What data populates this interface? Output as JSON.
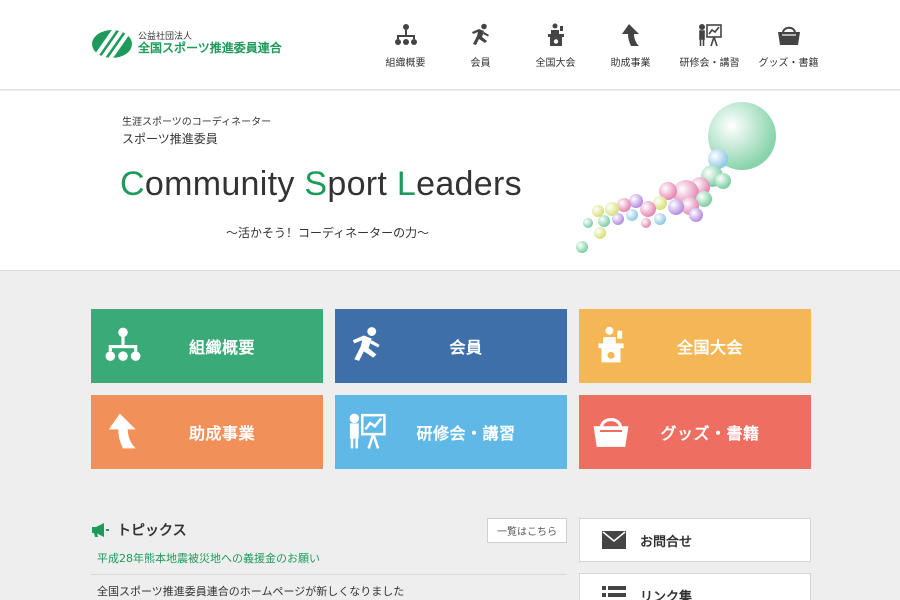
{
  "logo": {
    "sub": "公益社団法人",
    "main": "全国スポーツ推進委員連合"
  },
  "nav": [
    {
      "label": "組織概要",
      "icon": "org-chart-icon"
    },
    {
      "label": "会員",
      "icon": "runner-icon"
    },
    {
      "label": "全国大会",
      "icon": "podium-speaker-icon"
    },
    {
      "label": "助成事業",
      "icon": "up-arrow-icon"
    },
    {
      "label": "研修会・講習",
      "icon": "presentation-icon"
    },
    {
      "label": "グッズ・書籍",
      "icon": "basket-icon"
    }
  ],
  "hero": {
    "small": "生涯スポーツのコーディネーター",
    "sub": "スポーツ推進委員",
    "title_parts": [
      "C",
      "ommunity ",
      "S",
      "port ",
      "L",
      "eaders"
    ],
    "tagline": "〜活かそう！コーディネーターの力〜"
  },
  "tiles": [
    {
      "label": "組織概要",
      "icon": "org-chart-icon",
      "color": "#3aaa78"
    },
    {
      "label": "会員",
      "icon": "runner-icon",
      "color": "#3f6fa9"
    },
    {
      "label": "全国大会",
      "icon": "podium-speaker-icon",
      "color": "#f5b755"
    },
    {
      "label": "助成事業",
      "icon": "up-arrow-icon",
      "color": "#f29059"
    },
    {
      "label": "研修会・講習",
      "icon": "presentation-icon",
      "color": "#5fb8e6"
    },
    {
      "label": "グッズ・書籍",
      "icon": "basket-icon",
      "color": "#ee6f62"
    }
  ],
  "topics": {
    "title": "トピックス",
    "all_link": "一覧はこちら",
    "items": [
      "平成28年熊本地震被災地への義援金のお願い",
      "全国スポーツ推進委員連合のホームページが新しくなりました"
    ]
  },
  "side": [
    {
      "label": "お問合せ",
      "icon": "envelope-icon"
    },
    {
      "label": "リンク集",
      "icon": "list-icon"
    }
  ],
  "colors": {
    "brand_green": "#1e9b5a"
  }
}
